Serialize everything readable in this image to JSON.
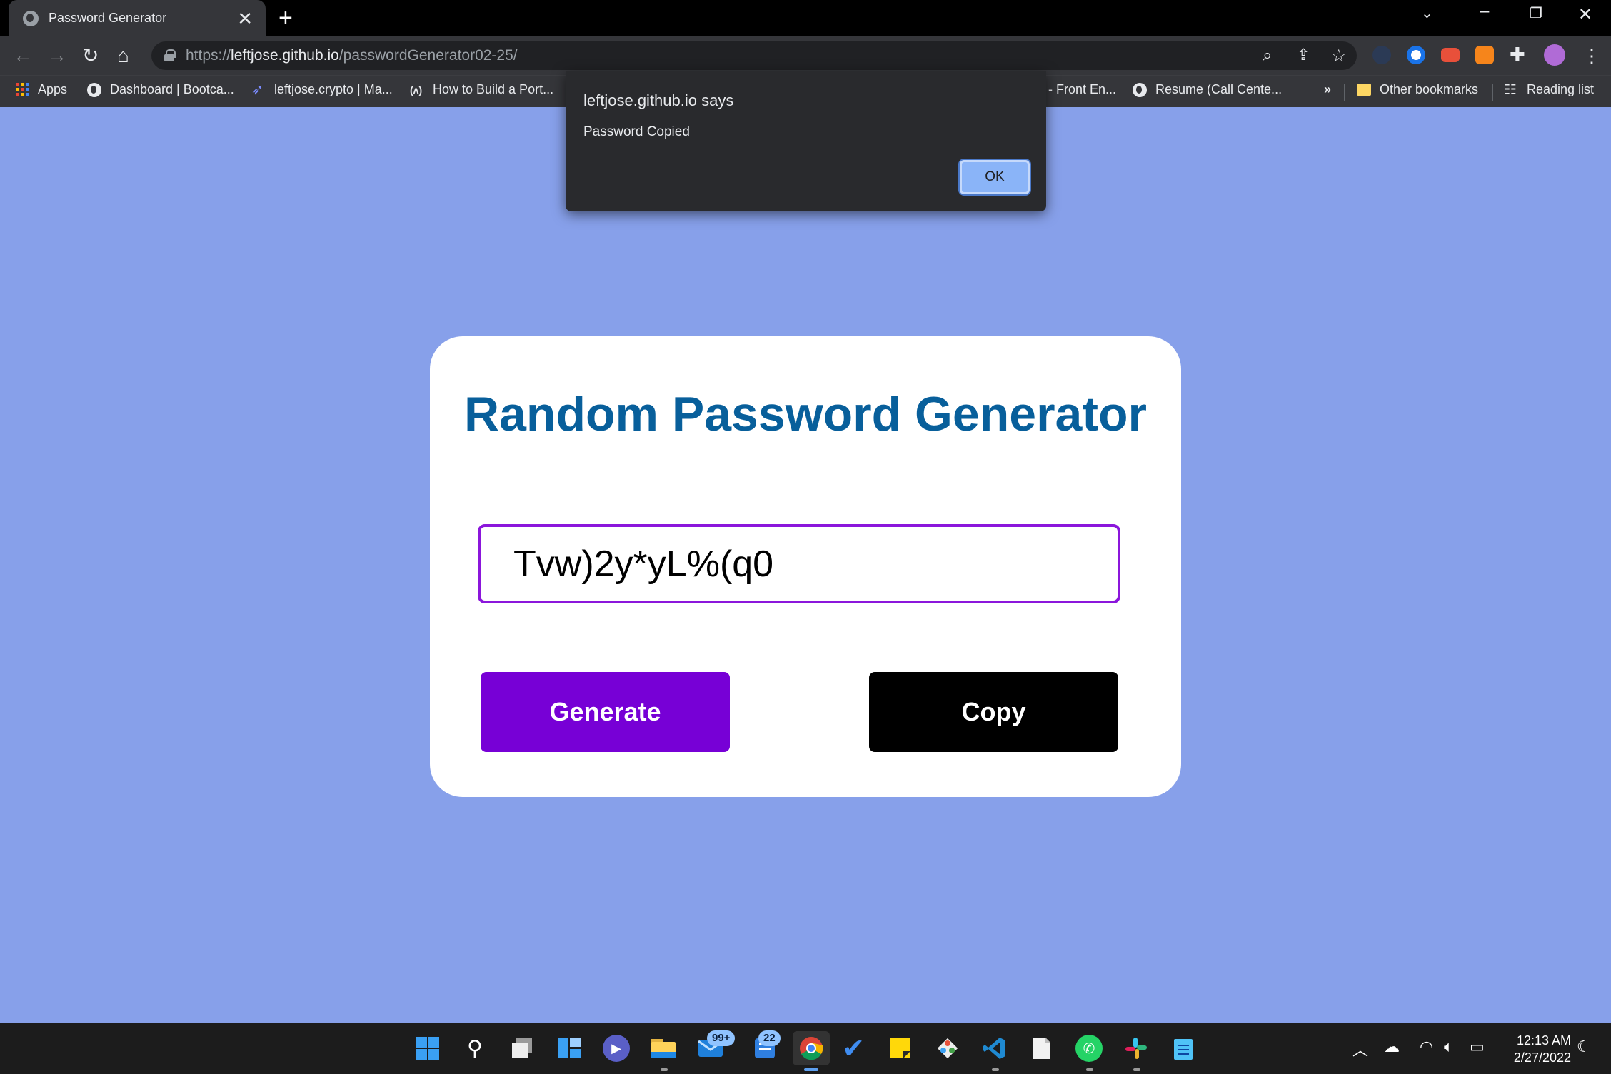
{
  "browser": {
    "tab_title": "Password Generator",
    "tab_close": "✕",
    "new_tab": "+",
    "url_scheme": "https://",
    "url_host": "leftjose.github.io",
    "url_path": "/passwordGenerator02-25/",
    "bookmarks": [
      {
        "label": "Apps",
        "icon": "apps-grid-icon"
      },
      {
        "label": "Dashboard | Bootca...",
        "icon": "globe-icon"
      },
      {
        "label": "leftjose.crypto | Ma...",
        "icon": "rocket-icon"
      },
      {
        "label": "How to Build a Port...",
        "icon": "code-icon"
      },
      {
        "label": "- Front En...",
        "icon": ""
      },
      {
        "label": "Resume (Call Cente...",
        "icon": "globe-icon"
      }
    ],
    "overflow_label": "»",
    "other_bookmarks": "Other bookmarks",
    "reading_list": "Reading list"
  },
  "dialog": {
    "title": "leftjose.github.io says",
    "message": "Password Copied",
    "ok_label": "OK"
  },
  "app": {
    "title": "Random Password Generator",
    "password_value": "Tvw)2y*yL%(q0",
    "generate_label": "Generate",
    "copy_label": "Copy"
  },
  "colors": {
    "page_background": "#87a0ea",
    "title_color": "#085f9b",
    "generate_button": "#7700d6",
    "copy_button": "#000000",
    "field_border": "#8b16db"
  },
  "taskbar": {
    "mail_badge": "99+",
    "teams_badge": "22",
    "time": "12:13 AM",
    "date": "2/27/2022"
  }
}
